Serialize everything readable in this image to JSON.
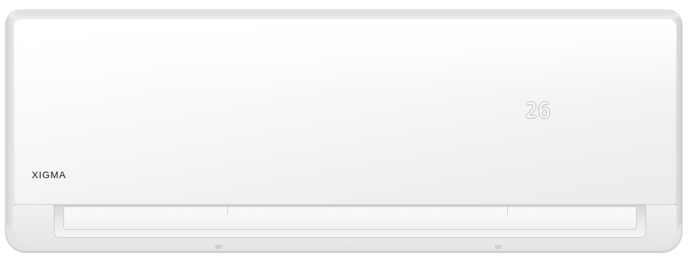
{
  "product": {
    "brand": "XIGMA",
    "display_temperature": "26"
  },
  "colors": {
    "body": "#eeeeee",
    "panel": "#fafafa",
    "logo_text": "#1a1a1a",
    "display_digits": "#ffffff"
  }
}
